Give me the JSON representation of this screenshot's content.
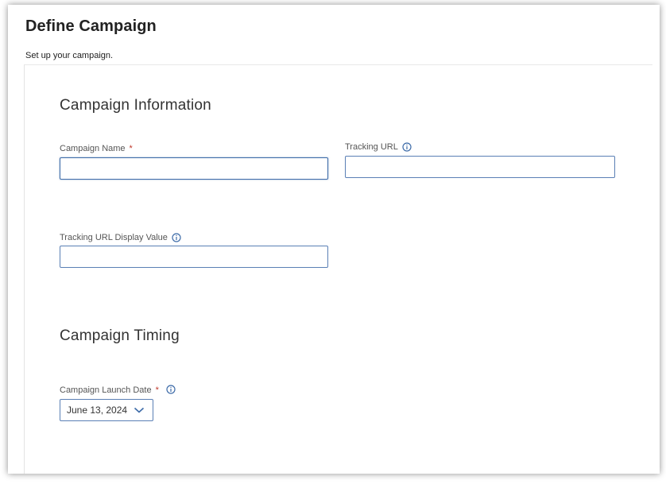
{
  "page": {
    "title": "Define Campaign",
    "subtitle": "Set up your campaign."
  },
  "campaign_information": {
    "heading": "Campaign Information",
    "campaign_name": {
      "label": "Campaign Name",
      "required_mark": "*",
      "value": ""
    },
    "tracking_url": {
      "label": "Tracking URL",
      "info_icon": "info-icon",
      "value": ""
    },
    "tracking_url_display_value": {
      "label": "Tracking URL Display Value",
      "info_icon": "info-icon",
      "value": ""
    }
  },
  "campaign_timing": {
    "heading": "Campaign Timing",
    "launch_date": {
      "label": "Campaign Launch Date",
      "required_mark": "*",
      "info_icon": "info-icon",
      "selected_value": "June 13, 2024",
      "dropdown_icon": "chevron-down-icon"
    }
  },
  "colors": {
    "input_border": "#5a7fb5",
    "required": "#c0392b",
    "info_icon": "#3d6ba8"
  }
}
